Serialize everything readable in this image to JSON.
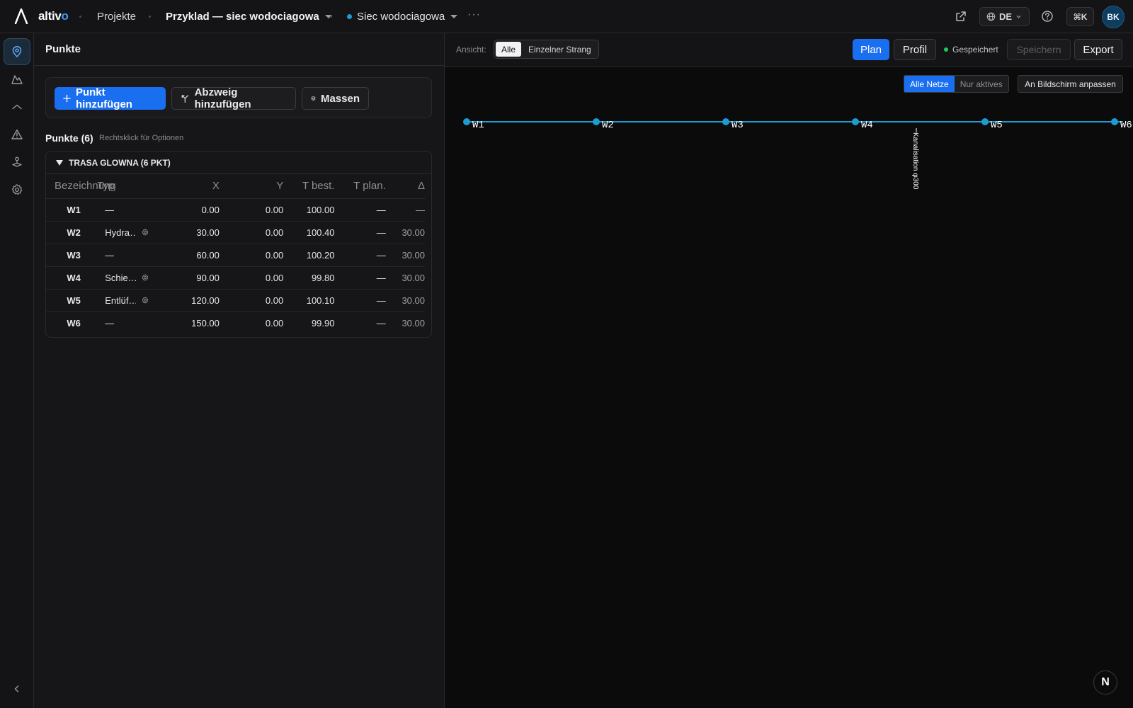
{
  "app": {
    "brand_main": "altiv",
    "brand_accent": "o",
    "accent_color": "#1a6ff0",
    "network_color": "#1e9bd1"
  },
  "topbar": {
    "projects_label": "Projekte",
    "project_name": "Przyklad — siec wodociagowa",
    "network_name": "Siec wodociagowa",
    "more_label": "···",
    "lang_label": "DE",
    "cmdk_label": "⌘K",
    "avatar_initials": "BK"
  },
  "rail": {
    "items": [
      {
        "icon": "map-pin-icon",
        "active": true
      },
      {
        "icon": "terrain-icon",
        "active": false
      },
      {
        "icon": "profile-curve-icon",
        "active": false
      },
      {
        "icon": "warning-icon",
        "active": false
      },
      {
        "icon": "joystick-icon",
        "active": false
      },
      {
        "icon": "gear-icon",
        "active": false
      }
    ],
    "collapse_icon": "chevron-left-icon"
  },
  "panel": {
    "title": "Punkte",
    "buttons": {
      "add_point": "Punkt hinzufügen",
      "add_branch": "Abzweig hinzufügen",
      "masses": "Massen"
    },
    "list_title": "Punkte (6)",
    "list_hint": "Rechtsklick für Optionen",
    "group_label": "TRASA GLOWNA (6 PKT)",
    "columns": [
      "Bezeichnung",
      "Typ",
      "X",
      "Y",
      "T best.",
      "T plan.",
      "Δ"
    ],
    "rows": [
      {
        "name": "W1",
        "type": "—",
        "has_gear": false,
        "x": "0.00",
        "y": "0.00",
        "t_best": "100.00",
        "t_plan": "—",
        "delta": "—"
      },
      {
        "name": "W2",
        "type": "Hydra…",
        "has_gear": true,
        "x": "30.00",
        "y": "0.00",
        "t_best": "100.40",
        "t_plan": "—",
        "delta": "30.00"
      },
      {
        "name": "W3",
        "type": "—",
        "has_gear": false,
        "x": "60.00",
        "y": "0.00",
        "t_best": "100.20",
        "t_plan": "—",
        "delta": "30.00"
      },
      {
        "name": "W4",
        "type": "Schie…",
        "has_gear": true,
        "x": "90.00",
        "y": "0.00",
        "t_best": "99.80",
        "t_plan": "—",
        "delta": "30.00"
      },
      {
        "name": "W5",
        "type": "Entlüf…",
        "has_gear": true,
        "x": "120.00",
        "y": "0.00",
        "t_best": "100.10",
        "t_plan": "—",
        "delta": "30.00"
      },
      {
        "name": "W6",
        "type": "—",
        "has_gear": false,
        "x": "150.00",
        "y": "0.00",
        "t_best": "99.90",
        "t_plan": "—",
        "delta": "30.00"
      }
    ]
  },
  "canvas": {
    "view_label": "Ansicht:",
    "view_options": [
      "Alle",
      "Einzelner Strang"
    ],
    "view_active": "Alle",
    "plan_label": "Plan",
    "profil_label": "Profil",
    "saved_label": "Gespeichert",
    "save_label": "Speichern",
    "export_label": "Export",
    "net_options": [
      "Alle Netze",
      "Nur aktives"
    ],
    "net_active": "Alle Netze",
    "fit_label": "An Bildschirm anpassen",
    "crossing_label": "Kanalisation φ300",
    "node_labels": [
      "W1",
      "W2",
      "W3",
      "W4",
      "W5",
      "W6"
    ],
    "n_badge": "N"
  }
}
